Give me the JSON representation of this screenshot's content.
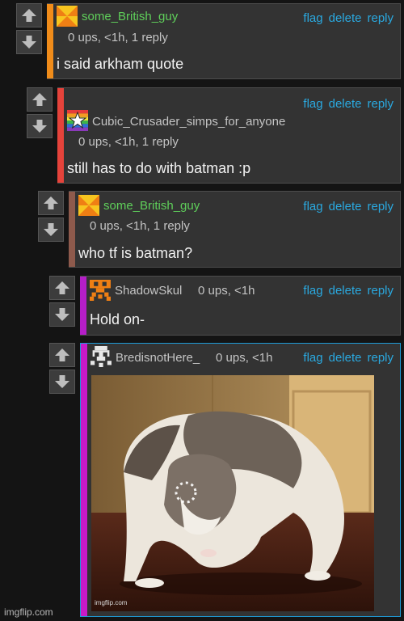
{
  "actions": {
    "flag": "flag",
    "delete": "delete",
    "reply": "reply"
  },
  "colors": {
    "link": "#2aa9e0",
    "username_green": "#5fcf5a",
    "username_gray": "#c4c4c4",
    "bar_orange": "#f08c1a",
    "bar_red": "#e5433b",
    "bar_brown": "#8e5a4c",
    "bar_purple": "#b51ec8",
    "bar_magenta": "#c819c8",
    "highlight_border": "#1e9ad6"
  },
  "comments": [
    {
      "username": "some_British_guy",
      "meta": "0 ups, <1h, 1 reply",
      "text": "i said arkham quote",
      "avatar": "orange-yellow-pinwheel-icon"
    },
    {
      "username": "Cubic_Crusader_simps_for_anyone",
      "meta": "0 ups, <1h, 1 reply",
      "text": "still has to do with batman :p",
      "avatar": "rainbow-star-icon"
    },
    {
      "username": "some_British_guy",
      "meta": "0 ups, <1h, 1 reply",
      "text": "who tf is batman?",
      "avatar": "orange-yellow-pinwheel-icon"
    },
    {
      "username": "ShadowSkul",
      "meta": "0 ups, <1h",
      "text": "Hold on-",
      "avatar": "orange-pixel-skull-icon"
    },
    {
      "username": "BredisnotHere_",
      "meta": "0 ups, <1h",
      "image": "loading-cat-image",
      "image_watermark": "imgflip.com",
      "avatar": "white-pixel-skull-icon"
    }
  ],
  "footer_watermark": "imgflip.com"
}
